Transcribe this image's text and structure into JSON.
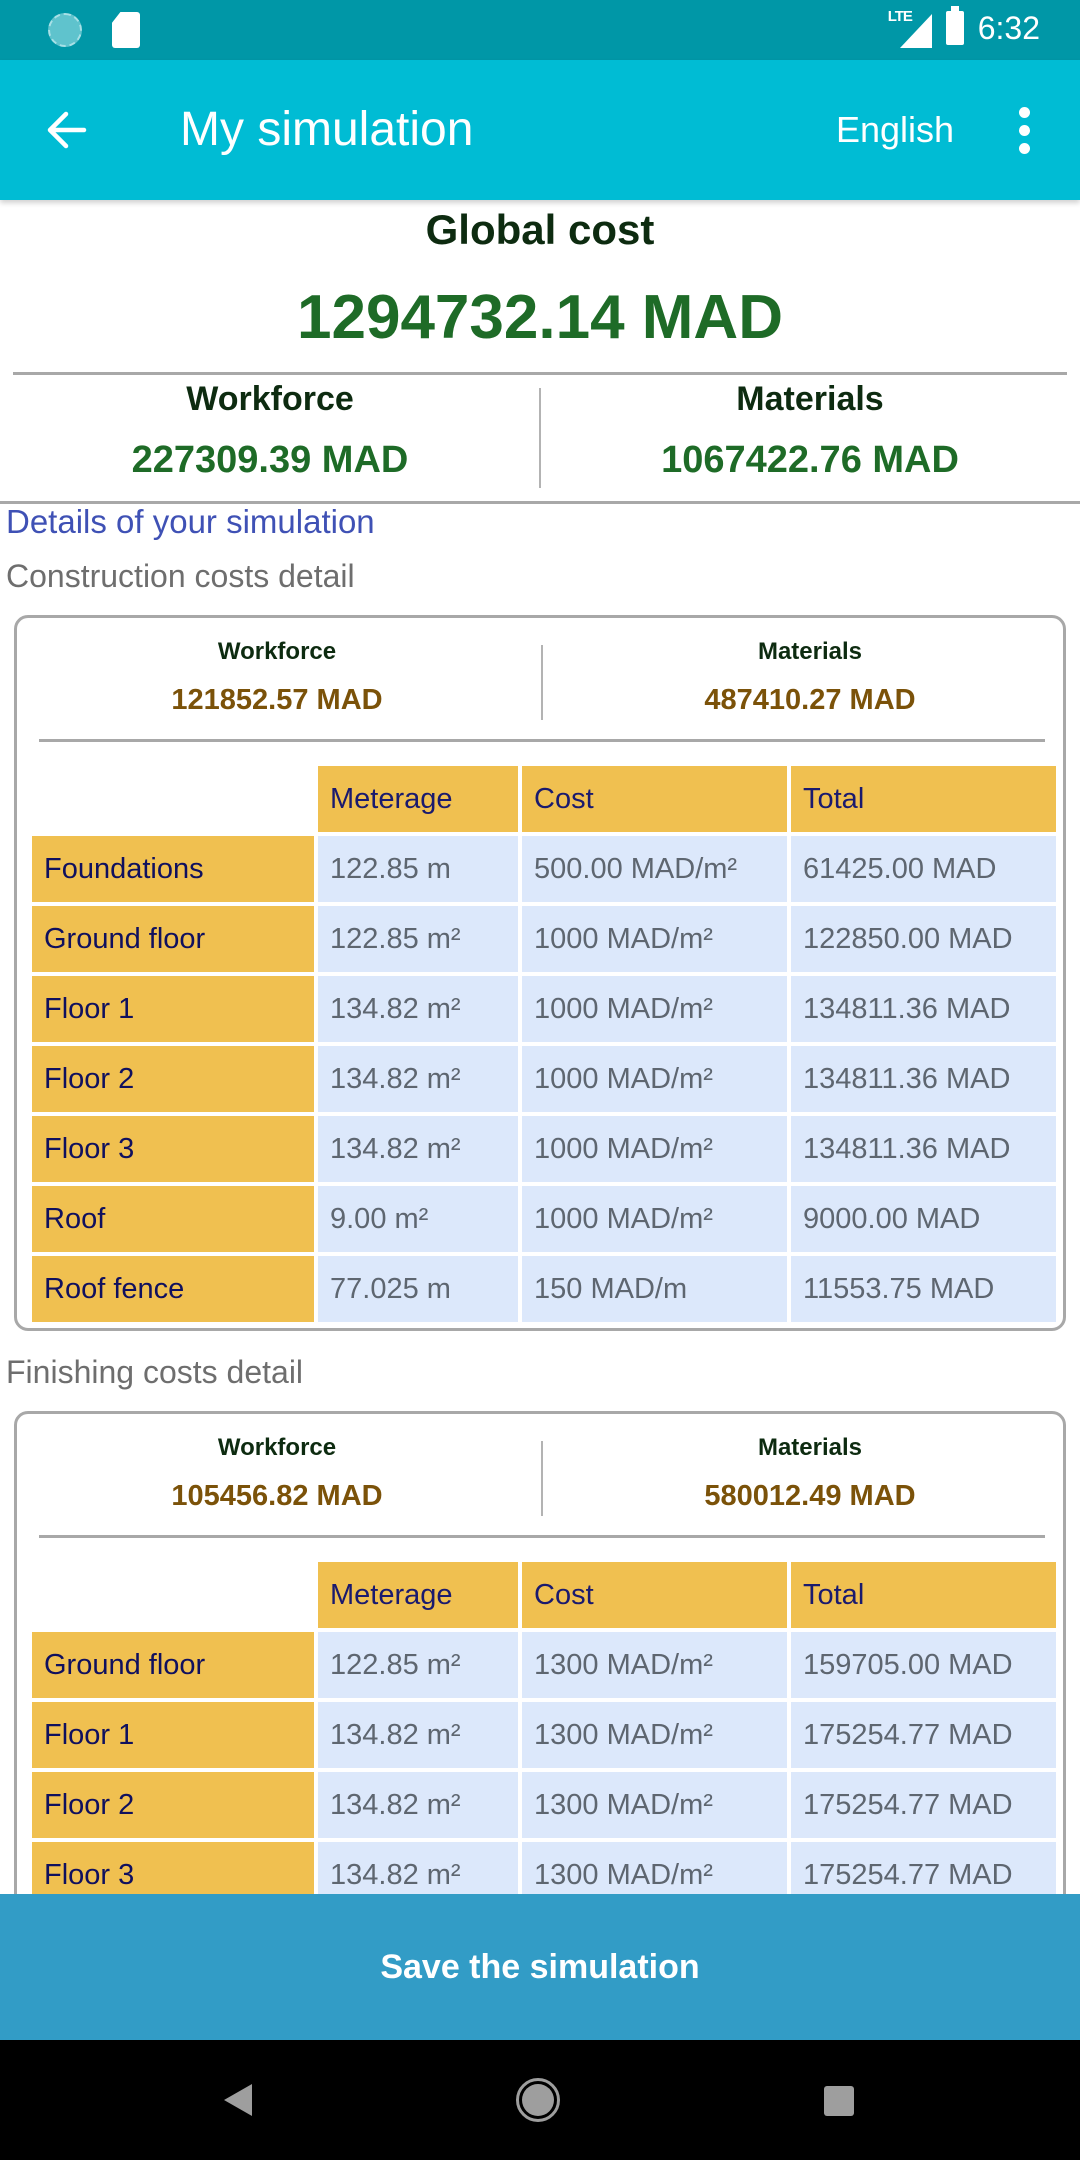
{
  "status_bar": {
    "time": "6:32",
    "network": "LTE",
    "icons": [
      "loading-dial-icon",
      "sd-card-icon",
      "lte-signal-icon",
      "battery-icon"
    ]
  },
  "app_bar": {
    "title": "My simulation",
    "language": "English",
    "back_icon": "arrow-left-icon",
    "menu_icon": "more-vertical-icon"
  },
  "global": {
    "title": "Global cost",
    "value": "1294732.14 MAD",
    "workforce_label": "Workforce",
    "workforce_value": "227309.39 MAD",
    "materials_label": "Materials",
    "materials_value": "1067422.76 MAD"
  },
  "details_title": "Details of your simulation",
  "columns": [
    "Meterage",
    "Cost",
    "Total"
  ],
  "construction": {
    "title": "Construction costs detail",
    "workforce_label": "Workforce",
    "workforce_value": "121852.57 MAD",
    "materials_label": "Materials",
    "materials_value": "487410.27 MAD",
    "rows": [
      {
        "label": "Foundations",
        "meterage": "122.85 m",
        "cost": "500.00 MAD/m²",
        "total": "61425.00 MAD"
      },
      {
        "label": "Ground floor",
        "meterage": "122.85 m²",
        "cost": "1000 MAD/m²",
        "total": "122850.00 MAD"
      },
      {
        "label": "Floor 1",
        "meterage": "134.82 m²",
        "cost": "1000 MAD/m²",
        "total": "134811.36 MAD"
      },
      {
        "label": "Floor 2",
        "meterage": "134.82 m²",
        "cost": "1000 MAD/m²",
        "total": "134811.36 MAD"
      },
      {
        "label": "Floor 3",
        "meterage": "134.82 m²",
        "cost": "1000 MAD/m²",
        "total": "134811.36 MAD"
      },
      {
        "label": "Roof",
        "meterage": "9.00 m²",
        "cost": "1000 MAD/m²",
        "total": "9000.00 MAD"
      },
      {
        "label": "Roof fence",
        "meterage": "77.025 m",
        "cost": "150 MAD/m",
        "total": "11553.75 MAD"
      }
    ]
  },
  "finishing": {
    "title": "Finishing costs detail",
    "workforce_label": "Workforce",
    "workforce_value": "105456.82 MAD",
    "materials_label": "Materials",
    "materials_value": "580012.49 MAD",
    "rows": [
      {
        "label": "Ground floor",
        "meterage": "122.85 m²",
        "cost": "1300 MAD/m²",
        "total": "159705.00 MAD"
      },
      {
        "label": "Floor 1",
        "meterage": "134.82 m²",
        "cost": "1300 MAD/m²",
        "total": "175254.77 MAD"
      },
      {
        "label": "Floor 2",
        "meterage": "134.82 m²",
        "cost": "1300 MAD/m²",
        "total": "175254.77 MAD"
      },
      {
        "label": "Floor 3",
        "meterage": "134.82 m²",
        "cost": "1300 MAD/m²",
        "total": "175254.77 MAD"
      }
    ]
  },
  "save_button": "Save the simulation",
  "colors": {
    "app_bar": "#00bcd4",
    "status_bar": "#0097a7",
    "accent_green": "#1e6b27",
    "accent_brown": "#7b5209",
    "table_header": "#f0c050",
    "table_cell": "#dce8fb",
    "save_button": "#329cc6",
    "details_title": "#3f51b5"
  }
}
